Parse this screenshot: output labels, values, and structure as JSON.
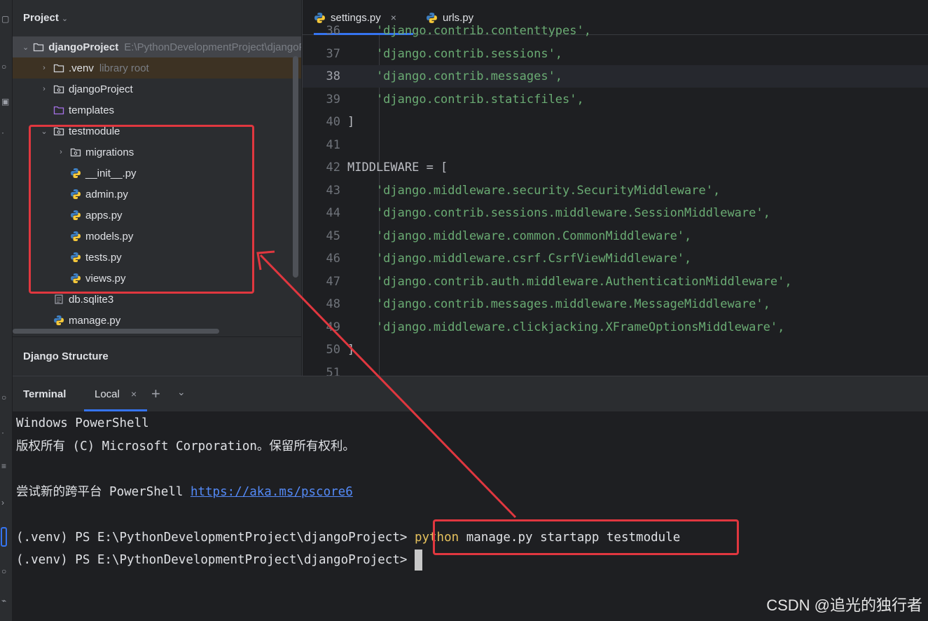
{
  "project_panel": {
    "title": "Project",
    "tree": [
      {
        "label": "djangoProject",
        "hint": "E:\\PythonDevelopmentProject\\djangoProject",
        "arrow": "⌄",
        "icon": "folder-icon"
      },
      {
        "label": ".venv",
        "hint": "library root",
        "arrow": "›",
        "icon": "folder-icon"
      },
      {
        "label": "djangoProject",
        "hint": "",
        "arrow": "›",
        "icon": "package-folder-icon"
      },
      {
        "label": "templates",
        "hint": "",
        "arrow": "",
        "icon": "templates-folder-icon"
      },
      {
        "label": "testmodule",
        "hint": "",
        "arrow": "⌄",
        "icon": "package-folder-icon"
      },
      {
        "label": "migrations",
        "hint": "",
        "arrow": "›",
        "icon": "package-folder-icon"
      },
      {
        "label": "__init__.py",
        "hint": "",
        "arrow": "",
        "icon": "python-file-icon"
      },
      {
        "label": "admin.py",
        "hint": "",
        "arrow": "",
        "icon": "python-file-icon"
      },
      {
        "label": "apps.py",
        "hint": "",
        "arrow": "",
        "icon": "python-file-icon"
      },
      {
        "label": "models.py",
        "hint": "",
        "arrow": "",
        "icon": "python-file-icon"
      },
      {
        "label": "tests.py",
        "hint": "",
        "arrow": "",
        "icon": "python-file-icon"
      },
      {
        "label": "views.py",
        "hint": "",
        "arrow": "",
        "icon": "python-file-icon"
      },
      {
        "label": "db.sqlite3",
        "hint": "",
        "arrow": "",
        "icon": "database-file-icon"
      },
      {
        "label": "manage.py",
        "hint": "",
        "arrow": "",
        "icon": "python-file-icon"
      }
    ]
  },
  "django_structure": {
    "title": "Django Structure"
  },
  "editor": {
    "tabs": [
      {
        "label": "settings.py",
        "close": "×",
        "active": true
      },
      {
        "label": "urls.py",
        "close": "",
        "active": false
      }
    ],
    "lines": [
      {
        "num": "36",
        "code": "    'django.contrib.contenttypes',"
      },
      {
        "num": "37",
        "code": "    'django.contrib.sessions',"
      },
      {
        "num": "38",
        "code": "    'django.contrib.messages',"
      },
      {
        "num": "39",
        "code": "    'django.contrib.staticfiles',"
      },
      {
        "num": "40",
        "code": "]"
      },
      {
        "num": "41",
        "code": ""
      },
      {
        "num": "42",
        "code": "MIDDLEWARE = ["
      },
      {
        "num": "43",
        "code": "    'django.middleware.security.SecurityMiddleware',"
      },
      {
        "num": "44",
        "code": "    'django.contrib.sessions.middleware.SessionMiddleware',"
      },
      {
        "num": "45",
        "code": "    'django.middleware.common.CommonMiddleware',"
      },
      {
        "num": "46",
        "code": "    'django.middleware.csrf.CsrfViewMiddleware',"
      },
      {
        "num": "47",
        "code": "    'django.contrib.auth.middleware.AuthenticationMiddleware',"
      },
      {
        "num": "48",
        "code": "    'django.contrib.messages.middleware.MessageMiddleware',"
      },
      {
        "num": "49",
        "code": "    'django.middleware.clickjacking.XFrameOptionsMiddleware',"
      },
      {
        "num": "50",
        "code": "]"
      },
      {
        "num": "51",
        "code": ""
      }
    ],
    "current_line": "38"
  },
  "terminal": {
    "title": "Terminal",
    "tab_label": "Local",
    "tab_close": "×",
    "add_label": "+",
    "menu_label": "⌄",
    "lines": [
      {
        "text": "Windows PowerShell"
      },
      {
        "text": "版权所有 (C) Microsoft Corporation。保留所有权利。"
      },
      {
        "text": ""
      },
      {
        "text": "尝试新的跨平台 PowerShell ",
        "link": "https://aka.ms/pscore6"
      },
      {
        "text": ""
      },
      {
        "text": "(.venv) PS E:\\PythonDevelopmentProject\\djangoProject> ",
        "keyword": "python",
        "rest": " manage.py startapp testmodule"
      },
      {
        "text": "(.venv) PS E:\\PythonDevelopmentProject\\djangoProject> ",
        "cursor": true
      }
    ]
  },
  "watermark": "CSDN @追光的独行者",
  "colors": {
    "accent": "#3574f0",
    "annotation": "#e0373f",
    "string": "#6aab73",
    "keyword": "#e5c15d",
    "link": "#548af7"
  }
}
